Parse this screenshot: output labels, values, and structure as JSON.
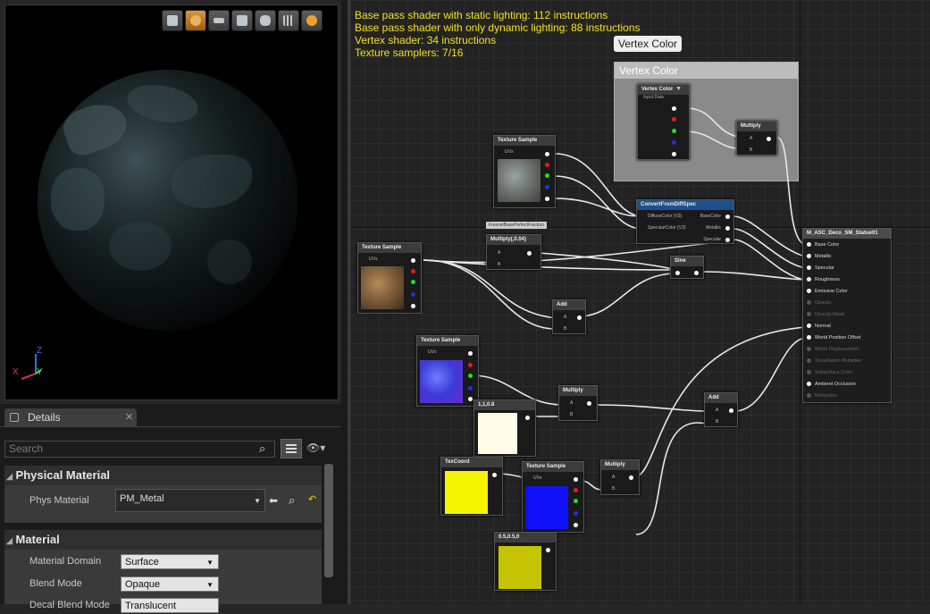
{
  "viewport": {
    "toolbar_icons": [
      "cylinder-icon",
      "sphere-icon",
      "plane-icon",
      "cube-icon",
      "mesh-icon",
      "grid-icon",
      "realtime-icon"
    ],
    "axis": {
      "x": "X",
      "y": "Y",
      "z": "Z"
    }
  },
  "details": {
    "tab_label": "Details",
    "search_placeholder": "Search",
    "categories": [
      {
        "label": "Physical Material",
        "props": [
          {
            "label": "Phys Material",
            "value": "PM_Metal"
          }
        ]
      },
      {
        "label": "Material",
        "props": [
          {
            "label": "Material Domain",
            "value": "Surface"
          },
          {
            "label": "Blend Mode",
            "value": "Opaque"
          },
          {
            "label": "Decal Blend Mode",
            "value": "Translucent"
          }
        ]
      }
    ]
  },
  "stats": [
    "Base pass shader with static lighting: 112 instructions",
    "Base pass shader with only dynamic lighting: 88 instructions",
    "Vertex shader: 34 instructions",
    "Texture samplers: 7/16"
  ],
  "comment": {
    "tooltip": "Vertex Color",
    "title": "Vertex Color"
  },
  "nodes": {
    "vertex_color": {
      "title": "Vertex Color",
      "subtitle": "Input Data"
    },
    "multiply_vc": {
      "title": "Multiply",
      "a": "A",
      "b": "B"
    },
    "tex1": {
      "title": "Texture Sample",
      "uvs": "UVs"
    },
    "convert": {
      "title": "ConvertFromDiffSpec",
      "in1": "DiffuseColor (V3)",
      "in2": "SpecularColor (V3)",
      "out1": "BaseColor",
      "out2": "Metallic",
      "out3": "Specular"
    },
    "fresnel_label": "FresnelBasePerfectFraction",
    "multiply004": {
      "title": "Multiply(,0.04)",
      "a": "A",
      "b": "B"
    },
    "tex2": {
      "title": "Texture Sample",
      "uvs": "UVs"
    },
    "sine": {
      "title": "Sine"
    },
    "add1": {
      "title": "Add",
      "a": "A",
      "b": "B"
    },
    "tex3": {
      "title": "Texture Sample",
      "uvs": "UVs"
    },
    "multiply2": {
      "title": "Multiply",
      "a": "A",
      "b": "B"
    },
    "const1": {
      "title": "1,1,0.8"
    },
    "add2": {
      "title": "Add",
      "a": "A",
      "b": "B"
    },
    "texcoord": {
      "title": "TexCoord"
    },
    "tex4": {
      "title": "Texture Sample",
      "uvs": "UVs"
    },
    "multiply3": {
      "title": "Multiply",
      "a": "A",
      "b": "B"
    },
    "const2": {
      "title": "0.5,0.5,0"
    },
    "result": {
      "title": "M_ASC_Deco_SM_Statue01",
      "inputs": [
        "Base Color",
        "Metallic",
        "Specular",
        "Roughness",
        "Emissive Color",
        "Opacity",
        "Opacity Mask",
        "Normal",
        "World Position Offset",
        "World Displacement",
        "Tessellation Multiplier",
        "Subsurface Color",
        "Ambient Occlusion",
        "Refraction"
      ]
    }
  },
  "colors": {
    "stats": "#f0e020",
    "active_tool": "#c27d25"
  }
}
